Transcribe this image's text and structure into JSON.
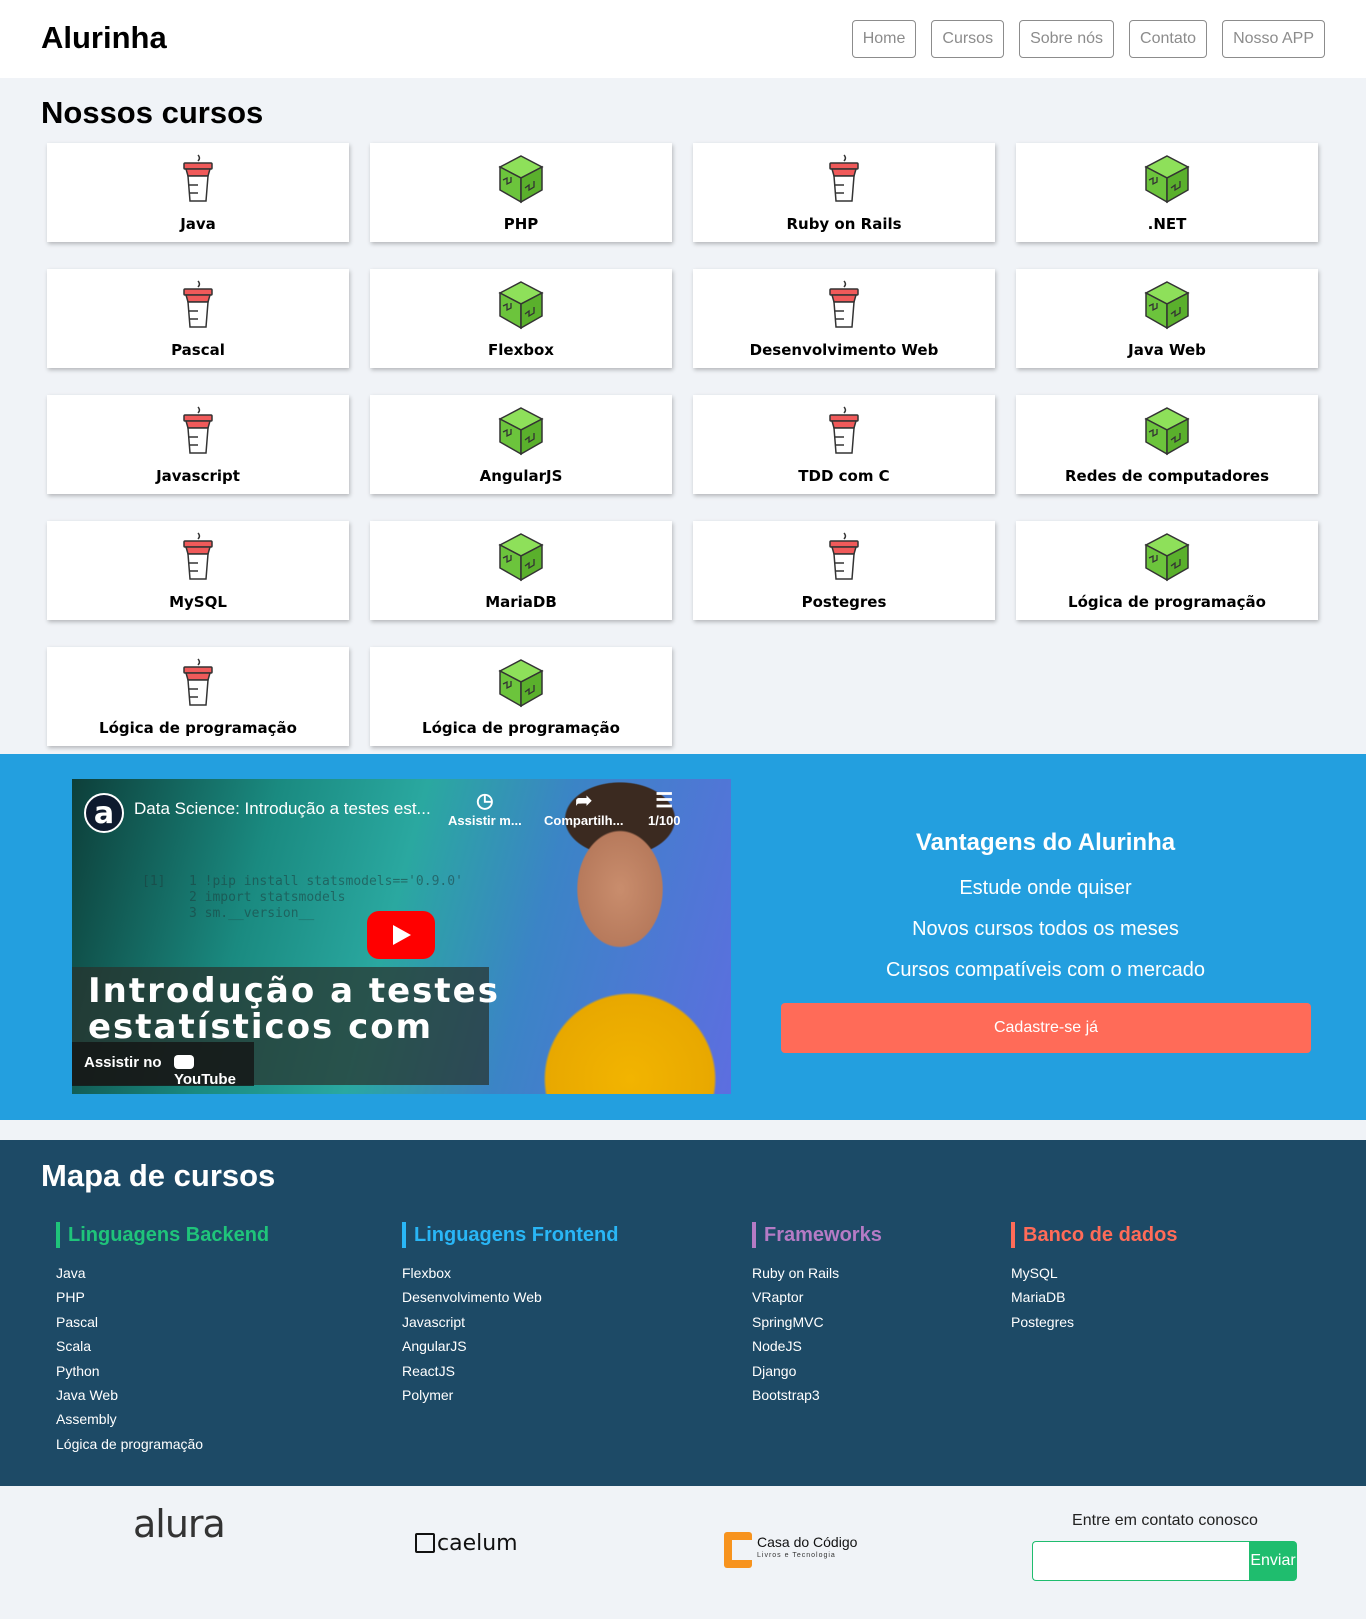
{
  "header": {
    "brand": "Alurinha",
    "nav": [
      "Home",
      "Cursos",
      "Sobre nós",
      "Contato",
      "Nosso APP"
    ]
  },
  "courses": {
    "title": "Nossos cursos",
    "items": [
      {
        "label": "Java",
        "icon": "cup-icon"
      },
      {
        "label": "PHP",
        "icon": "cube-icon"
      },
      {
        "label": "Ruby on Rails",
        "icon": "cup-icon"
      },
      {
        "label": ".NET",
        "icon": "cube-icon"
      },
      {
        "label": "Pascal",
        "icon": "cup-icon"
      },
      {
        "label": "Flexbox",
        "icon": "cube-icon"
      },
      {
        "label": "Desenvolvimento Web",
        "icon": "cup-icon"
      },
      {
        "label": "Java Web",
        "icon": "cube-icon"
      },
      {
        "label": "Javascript",
        "icon": "cup-icon"
      },
      {
        "label": "AngularJS",
        "icon": "cube-icon"
      },
      {
        "label": "TDD com C",
        "icon": "cup-icon"
      },
      {
        "label": "Redes de computadores",
        "icon": "cube-icon"
      },
      {
        "label": "MySQL",
        "icon": "cup-icon"
      },
      {
        "label": "MariaDB",
        "icon": "cube-icon"
      },
      {
        "label": "Postegres",
        "icon": "cup-icon"
      },
      {
        "label": "Lógica de programação",
        "icon": "cube-icon"
      },
      {
        "label": "Lógica de programação",
        "icon": "cup-icon"
      },
      {
        "label": "Lógica de programação",
        "icon": "cube-icon"
      }
    ]
  },
  "video": {
    "title": "Data Science: Introdução a testes est...",
    "watch_later": "Assistir m...",
    "share": "Compartilh...",
    "playlist": "1/100",
    "overlay_line1": "Introdução a testes",
    "overlay_line2": "estatísticos com",
    "watch_on": "Assistir no",
    "yt_brand": "YouTube",
    "channel_logo": "a"
  },
  "advantages": {
    "title": "Vantagens do Alurinha",
    "items": [
      "Estude onde quiser",
      "Novos cursos todos os meses",
      "Cursos compatíveis com o mercado"
    ],
    "cta": "Cadastre-se já"
  },
  "course_map": {
    "title": "Mapa de cursos",
    "columns": [
      {
        "heading": "Linguagens Backend",
        "color": "#1fc47a",
        "items": [
          "Java",
          "PHP",
          "Pascal",
          "Scala",
          "Python",
          "Java Web",
          "Assembly",
          "Lógica de programação"
        ]
      },
      {
        "heading": "Linguagens Frontend",
        "color": "#29b6f6",
        "items": [
          "Flexbox",
          "Desenvolvimento Web",
          "Javascript",
          "AngularJS",
          "ReactJS",
          "Polymer"
        ]
      },
      {
        "heading": "Frameworks",
        "color": "#b57bc5",
        "items": [
          "Ruby on Rails",
          "VRaptor",
          "SpringMVC",
          "NodeJS",
          "Django",
          "Bootstrap3"
        ]
      },
      {
        "heading": "Banco de dados",
        "color": "#ff6b58",
        "items": [
          "MySQL",
          "MariaDB",
          "Postegres"
        ]
      }
    ]
  },
  "footer": {
    "logos": {
      "alura": "alura",
      "caelum": "caelum",
      "cdc_name": "Casa do Código",
      "cdc_tagline": "Livros e Tecnologia"
    },
    "contact_label": "Entre em contato conosco",
    "contact_placeholder": "",
    "send_label": "Enviar"
  },
  "colors": {
    "header_bg": "#ffffff",
    "page_bg": "#f0f3f7",
    "blue_bg": "#239fdf",
    "map_bg": "#1d4a66",
    "cta": "#ff6b58",
    "send": "#1fbd6e"
  }
}
